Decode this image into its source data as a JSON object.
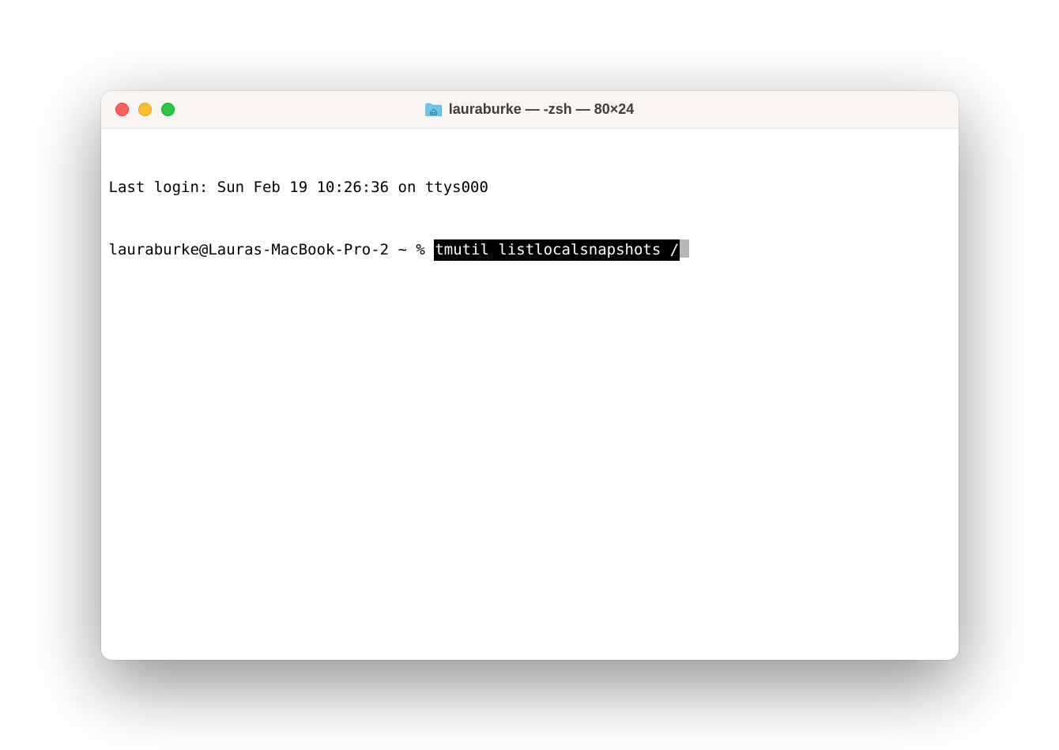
{
  "window": {
    "title": "lauraburke — -zsh — 80×24"
  },
  "terminal": {
    "last_login": "Last login: Sun Feb 19 10:26:36 on ttys000",
    "prompt": "lauraburke@Lauras-MacBook-Pro-2 ~ % ",
    "command": "tmutil listlocalsnapshots /"
  }
}
